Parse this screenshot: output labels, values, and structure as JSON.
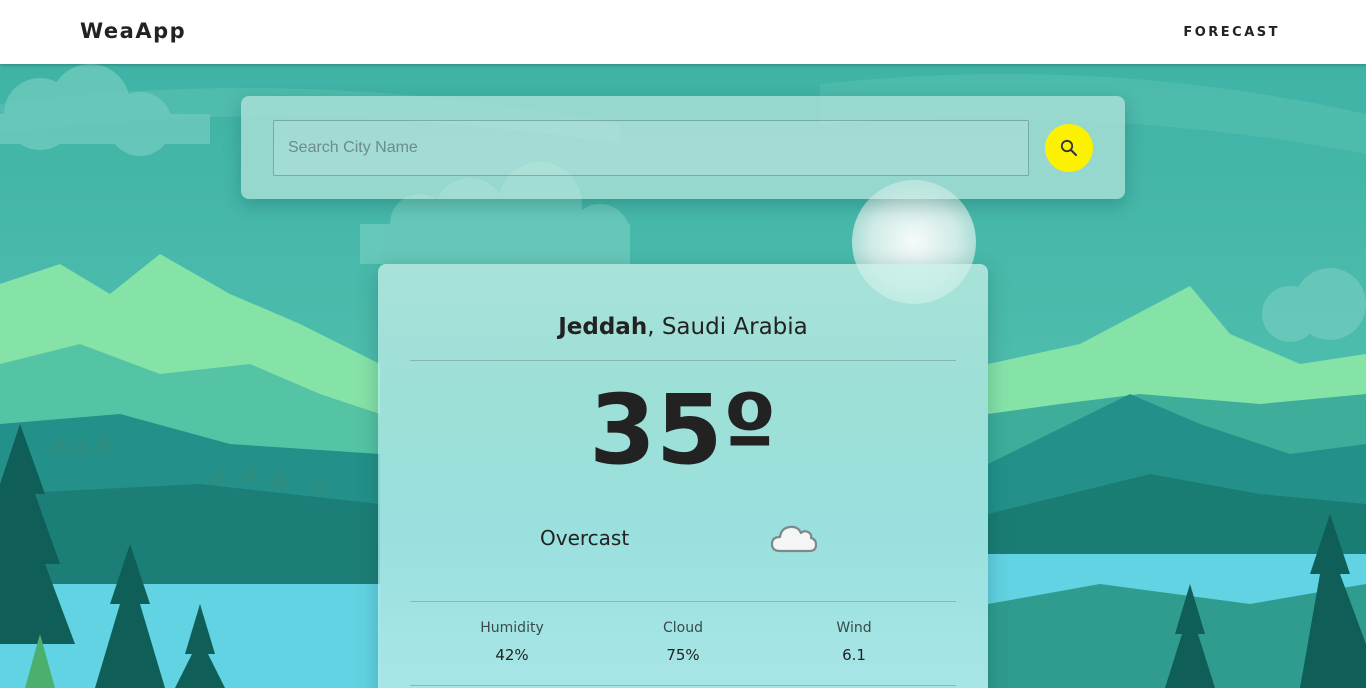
{
  "navbar": {
    "brand": "WeaApp",
    "link_label": "FORECAST"
  },
  "search": {
    "placeholder": "Search City Name",
    "value": ""
  },
  "weather": {
    "city": "Jeddah",
    "country": "Saudi Arabia",
    "temperature": "35º",
    "condition": "Overcast",
    "condition_icon": "cloud-icon",
    "stats": [
      {
        "label": "Humidity",
        "value": "42%"
      },
      {
        "label": "Cloud",
        "value": "75%"
      },
      {
        "label": "Wind",
        "value": "6.1"
      }
    ]
  },
  "colors": {
    "search_button": "#fbf100",
    "accent_teal": "#2aa59a"
  }
}
